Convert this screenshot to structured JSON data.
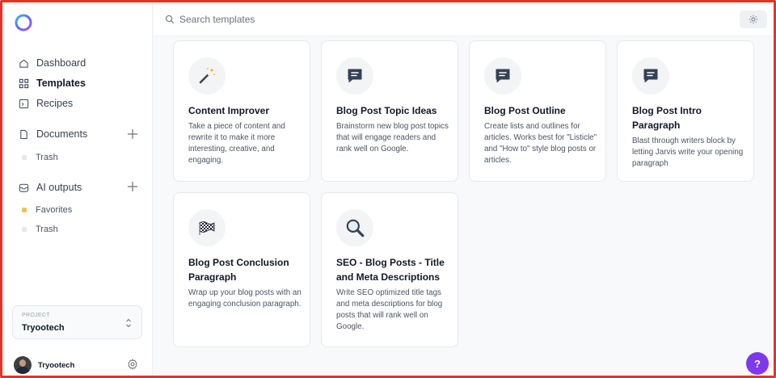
{
  "sidebar": {
    "nav": [
      {
        "label": "Dashboard",
        "icon": "home-icon"
      },
      {
        "label": "Templates",
        "icon": "grid-icon"
      },
      {
        "label": "Recipes",
        "icon": "terminal-icon"
      }
    ],
    "documents": {
      "label": "Documents",
      "sub": [
        {
          "label": "Trash"
        }
      ]
    },
    "ai_outputs": {
      "label": "AI outputs",
      "sub": [
        {
          "label": "Favorites"
        },
        {
          "label": "Trash"
        }
      ]
    },
    "project": {
      "label": "PROJECT",
      "name": "Tryootech"
    },
    "user": {
      "name": "Tryootech"
    }
  },
  "search": {
    "placeholder": "Search templates",
    "value": ""
  },
  "cards": [
    {
      "title": "Content Improver",
      "desc": "Take a piece of content and rewrite it to make it more interesting, creative, and engaging.",
      "icon": "magic-wand-icon"
    },
    {
      "title": "Blog Post Topic Ideas",
      "desc": "Brainstorm new blog post topics that will engage readers and rank well on Google.",
      "icon": "message-icon"
    },
    {
      "title": "Blog Post Outline",
      "desc": "Create lists and outlines for articles. Works best for \"Listicle\" and \"How to\" style blog posts or articles.",
      "icon": "message-icon"
    },
    {
      "title": "Blog Post Intro Paragraph",
      "desc": "Blast through writers block by letting Jarvis write your opening paragraph",
      "icon": "message-icon"
    },
    {
      "title": "Blog Post Conclusion Paragraph",
      "desc": "Wrap up your blog posts with an engaging conclusion paragraph.",
      "icon": "checkered-flag-icon"
    },
    {
      "title": "SEO - Blog Posts - Title and Meta Descriptions",
      "desc": "Write SEO optimized title tags and meta descriptions for blog posts that will rank well on Google.",
      "icon": "magnifier-icon"
    }
  ],
  "help": {
    "label": "?"
  },
  "colors": {
    "accent": "#7c3aed",
    "chat_icon": "#334155",
    "favorite_dot": "#f2c14e"
  }
}
